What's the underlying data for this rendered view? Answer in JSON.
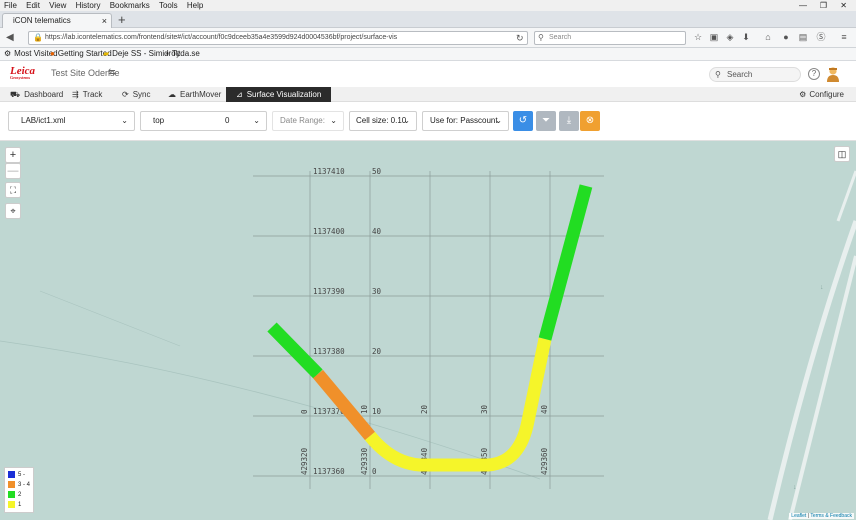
{
  "browser": {
    "menu": [
      "File",
      "Edit",
      "View",
      "History",
      "Bookmarks",
      "Tools",
      "Help"
    ],
    "tab_title": "iCON telematics",
    "tab_close": "×",
    "new_tab": "+",
    "url": "https://lab.icontelematics.com/frontend/site#/ict/account/f0c9dceeb35a4e3599d924d0004536bf/project/surface-vis",
    "search_placeholder": "Search",
    "bookmarks": [
      "Most Visited",
      "Getting Started",
      "Deje SS - Simidrott",
      "Tyda.se"
    ]
  },
  "app": {
    "logo_text": "Leica",
    "logo_sub": "Geosystems",
    "site_title": "Test Site Odense",
    "search_label": "Search",
    "help_label": "?"
  },
  "modules": {
    "items": [
      {
        "label": "Dashboard",
        "icon": "car-icon"
      },
      {
        "label": "Track",
        "icon": "track-icon"
      },
      {
        "label": "Sync",
        "icon": "sync-icon"
      },
      {
        "label": "EarthMover",
        "icon": "cloud-icon"
      },
      {
        "label": "Surface Visualization",
        "icon": "chart-icon",
        "active": true
      }
    ],
    "configure_label": "Configure"
  },
  "toolbar": {
    "file_value": "LAB/ict1.xml",
    "layer_value": "top",
    "layer_number": "0",
    "date_range_label": "Date Range:",
    "cell_size_label": "Cell size: 0.10",
    "use_for_label": "Use for: Passcount",
    "colors": {
      "refresh": "#3a8ee6",
      "filter": "#b0b8c0",
      "download": "#b0b8c0",
      "clear": "#f0a030"
    }
  },
  "map": {
    "grid_northings": [
      "1137410",
      "1137400",
      "1137390",
      "1137380",
      "1137370",
      "1137360"
    ],
    "grid_eastings": [
      "429320",
      "429330",
      "429340",
      "429350",
      "429360"
    ],
    "local_y_ticks": [
      "50",
      "40",
      "30",
      "20",
      "10",
      "0"
    ],
    "local_x_ticks": [
      "0",
      "10",
      "20",
      "30",
      "40"
    ],
    "legend": [
      {
        "label": "5 -",
        "color": "#1a2fd6"
      },
      {
        "label": "3 - 4",
        "color": "#f0902a"
      },
      {
        "label": "2",
        "color": "#22dd22"
      },
      {
        "label": "1",
        "color": "#f5f52a"
      }
    ],
    "attribution_leaflet": "Leaflet",
    "attribution_sep": " | ",
    "attribution_terms": "Terms & Feedback",
    "zoom_in": "+",
    "zoom_out": "—"
  }
}
